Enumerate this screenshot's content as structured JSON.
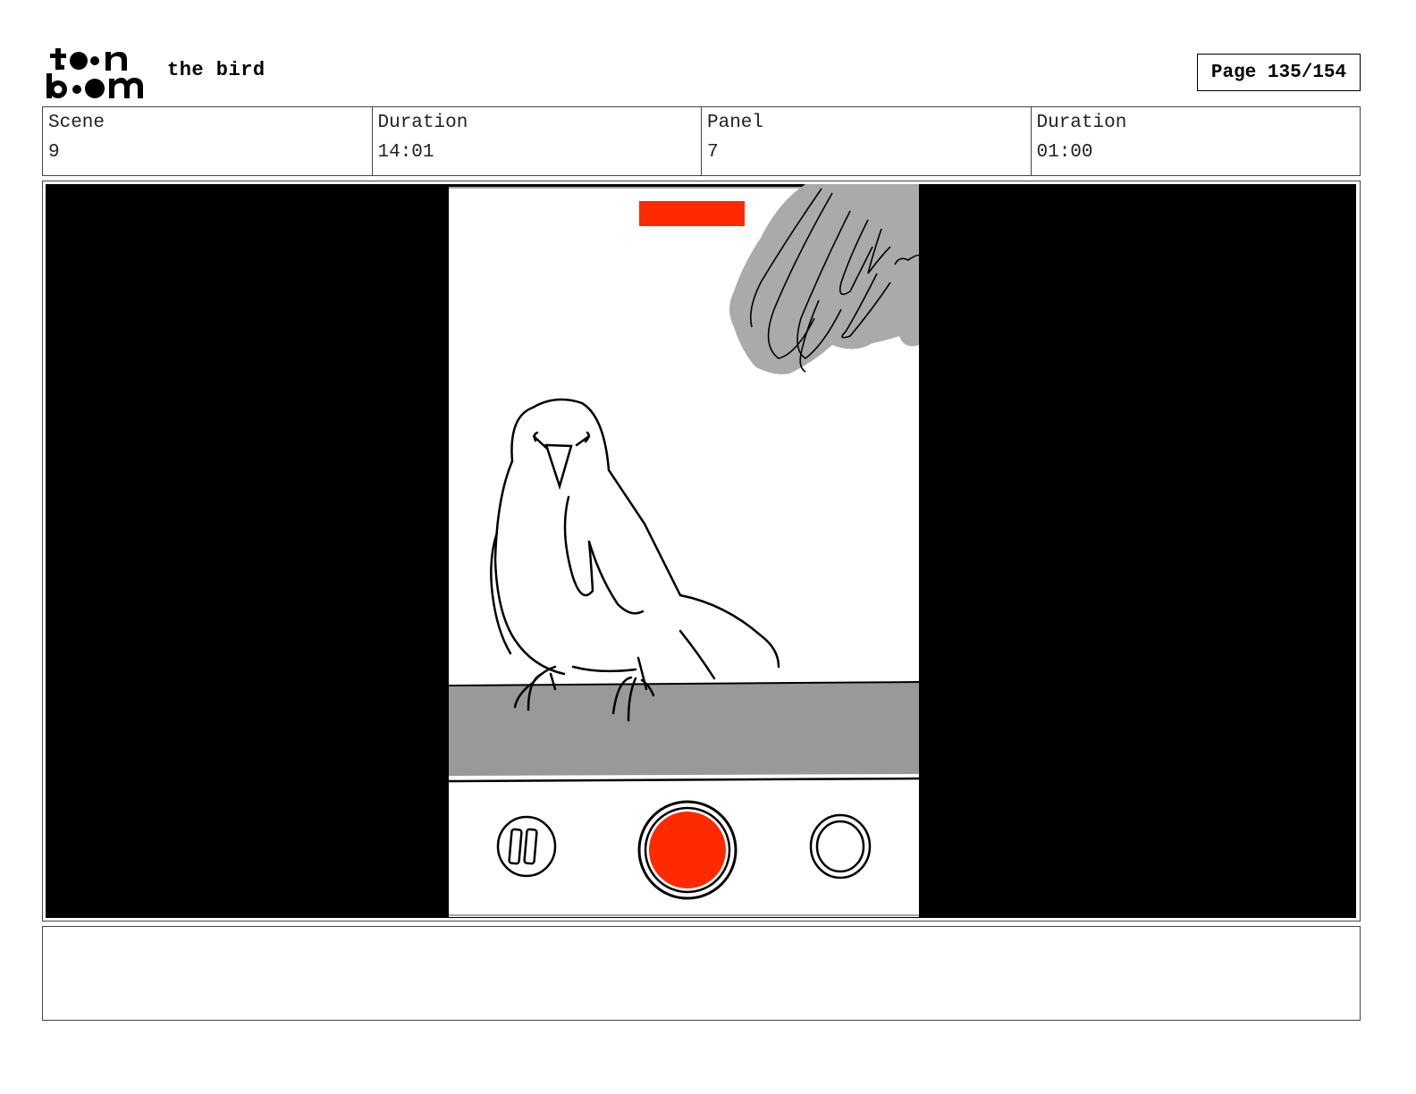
{
  "header": {
    "logo_icon": "toonboom-logo-icon",
    "project_title": "the bird",
    "page_label": "Page 135/154"
  },
  "info": {
    "scene_label": "Scene",
    "scene_value": "9",
    "scene_duration_label": "Duration",
    "scene_duration_value": "14:01",
    "panel_label": "Panel",
    "panel_value": "7",
    "panel_duration_label": "Duration",
    "panel_duration_value": "01:00"
  },
  "panel": {
    "description": "",
    "colors": {
      "background": "#000000",
      "screen": "#ffffff",
      "ledge": "#999999",
      "wing_shade": "#aaaaaa",
      "record_red": "#ff2a00"
    },
    "icons": [
      "bird-drawing-icon",
      "wing-sketch-icon",
      "record-indicator-icon",
      "pause-button-icon",
      "record-button-icon",
      "shutter-button-icon"
    ]
  },
  "notes": {
    "text": ""
  }
}
